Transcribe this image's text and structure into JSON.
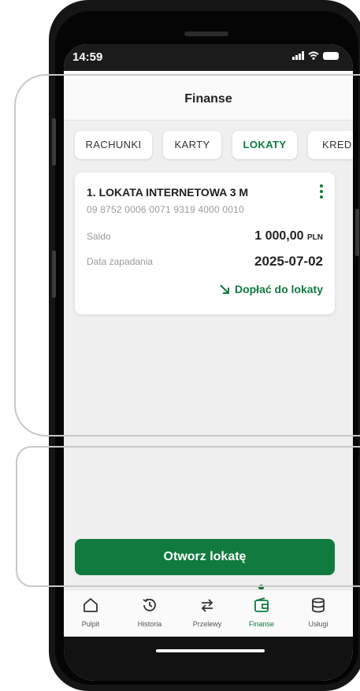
{
  "status_bar": {
    "time": "14:59"
  },
  "header": {
    "title": "Finanse"
  },
  "tabs": [
    {
      "label": "RACHUNKI",
      "active": false
    },
    {
      "label": "KARTY",
      "active": false
    },
    {
      "label": "LOKATY",
      "active": true
    },
    {
      "label": "KRED",
      "active": false
    }
  ],
  "deposit": {
    "name": "1. LOKATA INTERNETOWA 3 M",
    "account_number": "09 8752 0006 0071 9319 4000 0010",
    "balance_label": "Saldo",
    "balance_value": "1 000,00",
    "balance_currency": "PLN",
    "maturity_label": "Data zapadania",
    "maturity_value": "2025-07-02",
    "topup_label": "Dopłać do lokaty"
  },
  "open_button": {
    "label": "Otworz lokatę"
  },
  "bottom_nav": [
    {
      "label": "Pulpit",
      "icon": "home-icon",
      "active": false
    },
    {
      "label": "Historia",
      "icon": "history-icon",
      "active": false
    },
    {
      "label": "Przelewy",
      "icon": "transfer-icon",
      "active": false
    },
    {
      "label": "Finanse",
      "icon": "wallet-icon",
      "active": true
    },
    {
      "label": "Usługi",
      "icon": "database-icon",
      "active": false
    }
  ],
  "colors": {
    "accent": "#117a3e",
    "background": "#efefef"
  }
}
